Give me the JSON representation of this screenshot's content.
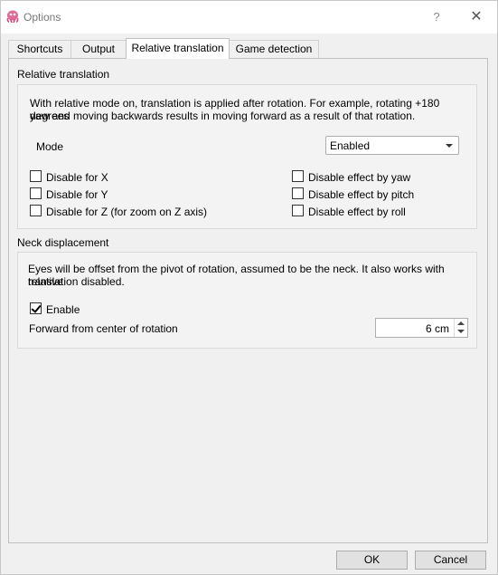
{
  "window": {
    "title": "Options",
    "help_symbol": "?",
    "close_symbol": "✕"
  },
  "tabs": [
    {
      "label": "Shortcuts",
      "active": false
    },
    {
      "label": "Output",
      "active": false
    },
    {
      "label": "Relative translation",
      "active": true
    },
    {
      "label": "Game detection",
      "active": false
    }
  ],
  "relative_translation": {
    "section_title": "Relative translation",
    "description_line1": "With relative mode on, translation is applied after rotation. For example, rotating +180 degrees",
    "description_line2": "yaw and moving backwards results in moving forward as a result of that rotation.",
    "mode_label": "Mode",
    "mode_value": "Enabled",
    "checkboxes": [
      {
        "label": "Disable for X",
        "checked": false
      },
      {
        "label": "Disable for Y",
        "checked": false
      },
      {
        "label": "Disable for Z (for zoom on Z axis)",
        "checked": false
      },
      {
        "label": "Disable effect by yaw",
        "checked": false
      },
      {
        "label": "Disable effect by pitch",
        "checked": false
      },
      {
        "label": "Disable effect by roll",
        "checked": false
      }
    ]
  },
  "neck_displacement": {
    "section_title": "Neck displacement",
    "description_line1": "Eyes will be offset from the pivot of rotation, assumed to be the neck. It also works with relative",
    "description_line2": "translation disabled.",
    "enable_label": "Enable",
    "enable_checked": true,
    "forward_label": "Forward from center of rotation",
    "forward_value": "6 cm"
  },
  "buttons": {
    "ok": "OK",
    "cancel": "Cancel"
  },
  "colors": {
    "icon": "#d9477a",
    "window_bg": "#f0f0f0"
  }
}
